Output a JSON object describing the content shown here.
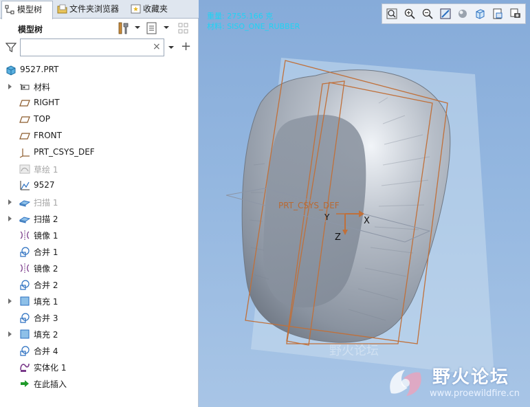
{
  "tabs": {
    "model_tree": "模型树",
    "folder_browser": "文件夹浏览器",
    "favorites": "收藏夹"
  },
  "panel": {
    "title": "模型树"
  },
  "filter": {
    "value": "",
    "clear_symbol": "×",
    "add_symbol": "+"
  },
  "tree": {
    "root": "9527.PRT",
    "items": [
      {
        "label": "材料",
        "icon": "material-icon",
        "expandable": true,
        "dim": false
      },
      {
        "label": "RIGHT",
        "icon": "datum-plane-icon",
        "expandable": false,
        "dim": false
      },
      {
        "label": "TOP",
        "icon": "datum-plane-icon",
        "expandable": false,
        "dim": false
      },
      {
        "label": "FRONT",
        "icon": "datum-plane-icon",
        "expandable": false,
        "dim": false
      },
      {
        "label": "PRT_CSYS_DEF",
        "icon": "csys-icon",
        "expandable": false,
        "dim": false
      },
      {
        "label": "草绘 1",
        "icon": "sketch-icon",
        "expandable": false,
        "dim": true
      },
      {
        "label": "9527",
        "icon": "graph-icon",
        "expandable": false,
        "dim": false
      },
      {
        "label": "扫描 1",
        "icon": "sweep-icon",
        "expandable": true,
        "dim": true
      },
      {
        "label": "扫描 2",
        "icon": "sweep-icon",
        "expandable": true,
        "dim": false
      },
      {
        "label": "镜像 1",
        "icon": "mirror-icon",
        "expandable": false,
        "dim": false
      },
      {
        "label": "合并 1",
        "icon": "merge-icon",
        "expandable": false,
        "dim": false
      },
      {
        "label": "镜像 2",
        "icon": "mirror-icon",
        "expandable": false,
        "dim": false
      },
      {
        "label": "合并 2",
        "icon": "merge-icon",
        "expandable": false,
        "dim": false
      },
      {
        "label": "填充 1",
        "icon": "fill-icon",
        "expandable": true,
        "dim": false
      },
      {
        "label": "合并 3",
        "icon": "merge-icon",
        "expandable": false,
        "dim": false
      },
      {
        "label": "填充 2",
        "icon": "fill-icon",
        "expandable": true,
        "dim": false
      },
      {
        "label": "合并 4",
        "icon": "merge-icon",
        "expandable": false,
        "dim": false
      },
      {
        "label": "实体化 1",
        "icon": "solidify-icon",
        "expandable": false,
        "dim": false
      },
      {
        "label": "在此插入",
        "icon": "insert-here-icon",
        "expandable": false,
        "dim": false
      }
    ]
  },
  "viewport": {
    "info_line1": "重量: 2755.166 克",
    "info_line2": "材料: SISO_ONE_RUBBER",
    "csys_label": "PRT_CSYS_DEF",
    "axis_x": "X",
    "axis_y": "Y",
    "axis_z": "Z"
  },
  "watermark": {
    "title": "野火论坛",
    "url": "www.proewildfire.cn",
    "faint_text": "野火论坛"
  },
  "colors": {
    "viewport_top": "#86abd9",
    "viewport_bottom": "#a8c5e6",
    "datum_orange": "#c0703a",
    "info_cyan": "#1fd3f3",
    "part_gray": "#a9b2bd"
  }
}
